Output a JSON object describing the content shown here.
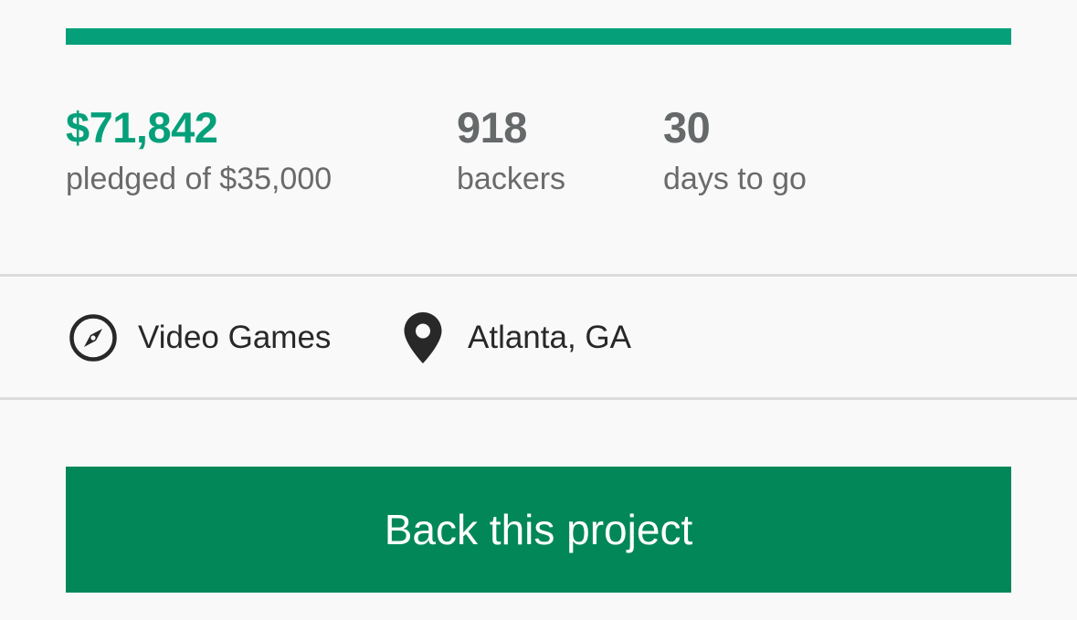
{
  "funding": {
    "progress_fraction": 1.0,
    "progress_color": "#05a07a",
    "pledged_amount": "$71,842",
    "pledged_label": "pledged of $35,000",
    "backers_count": "918",
    "backers_label": "backers",
    "days_count": "30",
    "days_label": "days to go"
  },
  "meta": {
    "category_icon": "compass-icon",
    "category": "Video Games",
    "location_icon": "map-pin-icon",
    "location": "Atlanta, GA"
  },
  "cta": {
    "back_label": "Back this project",
    "color": "#028858"
  }
}
